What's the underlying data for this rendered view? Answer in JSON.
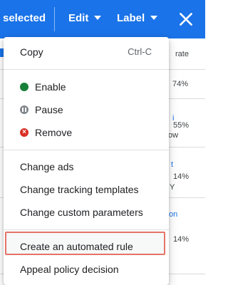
{
  "topbar": {
    "selected_text": "selected",
    "edit_label": "Edit",
    "label_label": "Label"
  },
  "table": {
    "header_rate": "rate",
    "row_cells": [
      "74%",
      "55%",
      "ow",
      "14%",
      "14%",
      "on",
      "Y"
    ]
  },
  "menu": {
    "copy": {
      "label": "Copy",
      "shortcut": "Ctrl-C"
    },
    "enable": {
      "label": "Enable",
      "icon": "green-dot-icon"
    },
    "pause": {
      "label": "Pause",
      "icon": "pause-icon"
    },
    "remove": {
      "label": "Remove",
      "icon": "remove-icon"
    },
    "change_ads": "Change ads",
    "change_tracking_templates": "Change tracking templates",
    "change_custom_parameters": "Change custom parameters",
    "create_automated_rule": "Create an automated rule",
    "appeal_policy_decision": "Appeal policy decision"
  },
  "colors": {
    "topbar": "#1a73e8",
    "enable": "#188038",
    "pause": "#80868b",
    "remove": "#d93025",
    "highlight_border": "#e57368"
  }
}
